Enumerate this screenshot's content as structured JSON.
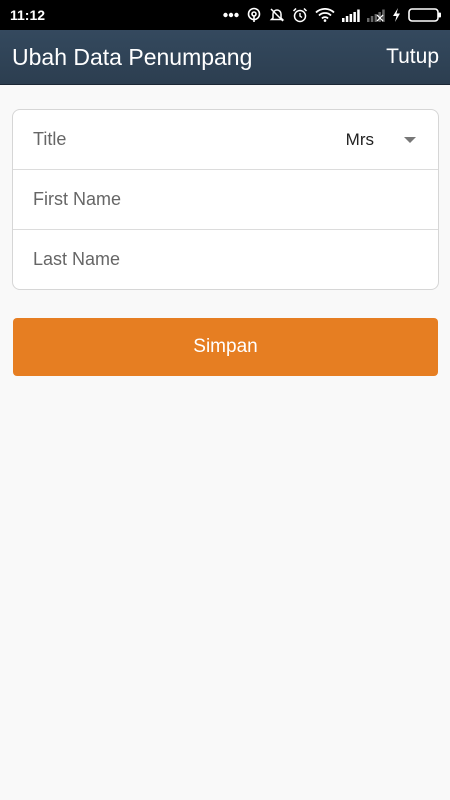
{
  "status_bar": {
    "time": "11:12",
    "icons": [
      "more-dots-icon",
      "hotspot-icon",
      "mute-icon",
      "alarm-icon",
      "wifi-icon",
      "signal-icon",
      "no-signal-icon",
      "charging-icon",
      "battery-icon"
    ]
  },
  "app_bar": {
    "title": "Ubah Data Penumpang",
    "close_label": "Tutup",
    "background": "#2c3e50"
  },
  "form": {
    "title_label": "Title",
    "title_value": "Mrs",
    "first_name_placeholder": "First Name",
    "last_name_placeholder": "Last Name"
  },
  "save_button": {
    "label": "Simpan",
    "color": "#e67e22"
  }
}
